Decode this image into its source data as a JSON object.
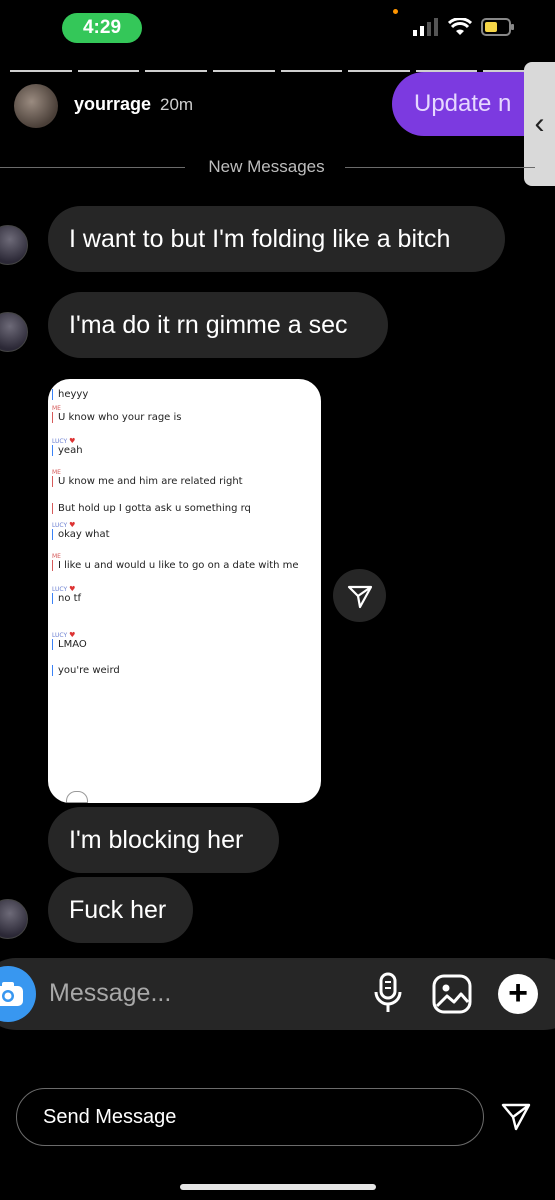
{
  "status_bar": {
    "time": "4:29"
  },
  "header": {
    "username": "yourrage",
    "time_ago": "20m",
    "update_button": "Update n"
  },
  "divider": {
    "label": "New Messages"
  },
  "messages": [
    {
      "text": "I want to but I'm folding like a bitch"
    },
    {
      "text": "I'ma do it rn gimme a sec"
    },
    {
      "text": "I'm blocking her"
    },
    {
      "text": "Fuck her"
    }
  ],
  "screenshot": {
    "lines": [
      {
        "label": "",
        "text": "heyyy"
      },
      {
        "label": "ME",
        "text": "U know who your rage is"
      },
      {
        "label": "LUCY",
        "text": "yeah"
      },
      {
        "label": "ME",
        "text": "U know me and him are related right"
      },
      {
        "label": "",
        "text": "But hold up I gotta ask u something rq"
      },
      {
        "label": "LUCY",
        "text": "okay what"
      },
      {
        "label": "ME",
        "text": "I like u and would u like to go on a date with me"
      },
      {
        "label": "LUCY",
        "text": "no tf"
      },
      {
        "label": "LUCY",
        "text": "LMAO"
      },
      {
        "label": "",
        "text": "you're weird"
      }
    ]
  },
  "composer": {
    "placeholder": "Message..."
  },
  "send_bar": {
    "label": "Send Message"
  },
  "colors": {
    "accent_purple": "#7c3ae0",
    "camera_blue": "#3897f0",
    "bubble": "#262626",
    "battery": "#f5d547",
    "time_pill": "#34c759"
  }
}
